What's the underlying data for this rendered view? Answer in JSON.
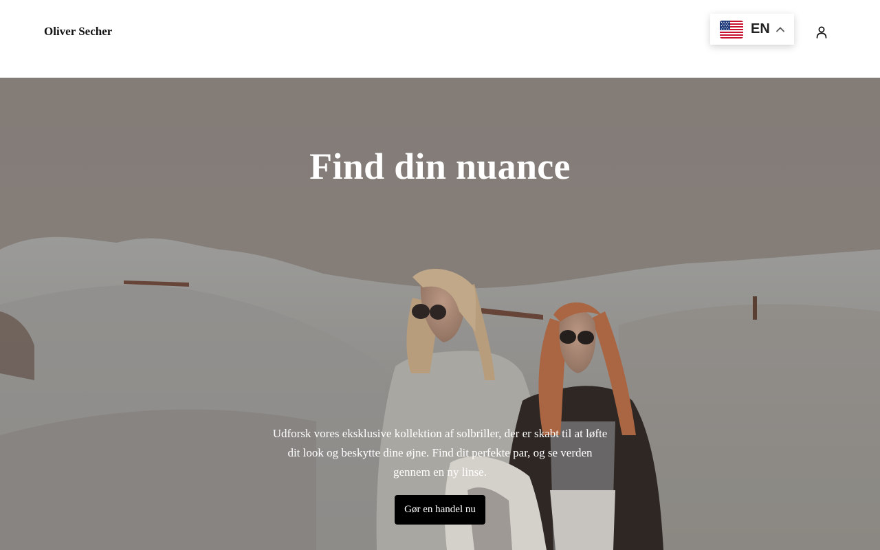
{
  "header": {
    "brand": "Oliver Secher",
    "language": {
      "code": "EN",
      "flag_icon": "us-flag-icon",
      "chevron_icon": "chevron-up-icon"
    },
    "account_icon": "user-icon"
  },
  "hero": {
    "title": "Find din nuance",
    "description": "Udforsk vores eksklusive kollektion af solbriller, der er skabt til at løfte dit look og beskytte dine øjne. Find dit perfekte par, og se verden gennem en ny linse.",
    "cta_label": "Gør en handel nu"
  },
  "colors": {
    "header_bg": "#ffffff",
    "cta_bg": "#000000",
    "hero_text": "#ffffff",
    "overlay": "#8c847f"
  }
}
